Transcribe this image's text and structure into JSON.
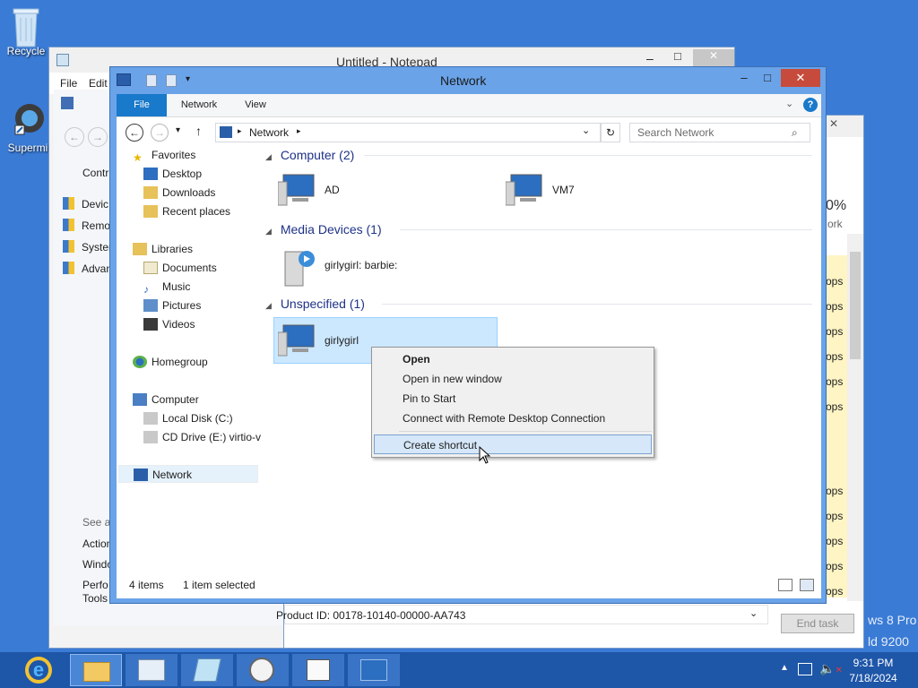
{
  "desktop": {
    "icons": [
      {
        "label": "Recycle"
      },
      {
        "label": "Supermi"
      }
    ],
    "watermark": [
      "ws 8 Pro",
      "ld 9200"
    ]
  },
  "notepad": {
    "title": "Untitled - Notepad",
    "menu": [
      "File",
      "Edit"
    ]
  },
  "control_panel": {
    "links": [
      "Contr",
      "Devic",
      "Remo",
      "Syster",
      "Advan"
    ],
    "see_also": "See al",
    "see_also_items": [
      "Action",
      "Windo",
      "Perfo",
      "Tools"
    ],
    "product_id": "Product ID: 00178-10140-00000-AA743"
  },
  "task_manager": {
    "percent": "0%",
    "col": "ork",
    "rows": [
      "ops",
      "ops",
      "ops",
      "ops",
      "ops",
      "ops",
      "ops",
      "ops",
      "ops",
      "ops",
      "ops",
      "ops"
    ],
    "end_task": "End task"
  },
  "explorer": {
    "title": "Network",
    "tabs": {
      "file": "File",
      "network": "Network",
      "view": "View"
    },
    "address": {
      "location": "Network"
    },
    "search": {
      "placeholder": "Search Network"
    },
    "nav": {
      "favorites": "Favorites",
      "desktop": "Desktop",
      "downloads": "Downloads",
      "recent": "Recent places",
      "libraries": "Libraries",
      "documents": "Documents",
      "music": "Music",
      "pictures": "Pictures",
      "videos": "Videos",
      "homegroup": "Homegroup",
      "computer": "Computer",
      "local_disk": "Local Disk (C:)",
      "cd_drive": "CD Drive (E:) virtio-v",
      "network": "Network"
    },
    "groups": {
      "computer": {
        "header": "Computer (2)",
        "items": [
          "AD",
          "VM7"
        ]
      },
      "media": {
        "header": "Media Devices (1)",
        "items": [
          "girlygirl: barbie:"
        ]
      },
      "unspecified": {
        "header": "Unspecified (1)",
        "items": [
          "girlygirl"
        ]
      }
    },
    "status": {
      "count": "4 items",
      "selected": "1 item selected"
    }
  },
  "context_menu": {
    "items": {
      "open": "Open",
      "open_new": "Open in new window",
      "pin": "Pin to Start",
      "rdp": "Connect with Remote Desktop Connection",
      "shortcut": "Create shortcut"
    }
  },
  "taskbar": {
    "time": "9:31 PM",
    "date": "7/18/2024"
  },
  "colors": {
    "desktop": "#3a7bd5",
    "accent": "#1e56a8",
    "selection": "#cce8ff",
    "file_tab": "#1979ca"
  }
}
